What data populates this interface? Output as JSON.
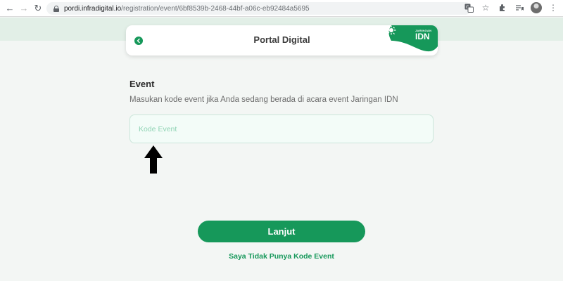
{
  "browser": {
    "url_domain": "pordi.infradigital.io",
    "url_path": "/registration/event/6bf8539b-2468-44bf-a06c-eb92484a5695"
  },
  "header": {
    "title": "Portal Digital",
    "logo_small": "JARINGAN",
    "logo_big": "IDN"
  },
  "form": {
    "title": "Event",
    "description": "Masukan kode event jika Anda sedang berada di acara event Jaringan IDN",
    "input_placeholder": "Kode Event",
    "input_value": ""
  },
  "actions": {
    "continue_label": "Lanjut",
    "no_code_label": "Saya Tidak Punya Kode Event"
  },
  "colors": {
    "brand_green": "#16985a",
    "input_bg": "#f3fcf8",
    "band_bg": "#e2efe7"
  },
  "icons": [
    "back-arrow-icon",
    "forward-arrow-icon",
    "reload-icon",
    "lock-icon",
    "translate-icon",
    "star-icon",
    "extensions-icon",
    "reading-list-icon",
    "menu-dots-icon",
    "chevron-left-icon",
    "sun-logo-icon",
    "up-arrow-annotation"
  ]
}
